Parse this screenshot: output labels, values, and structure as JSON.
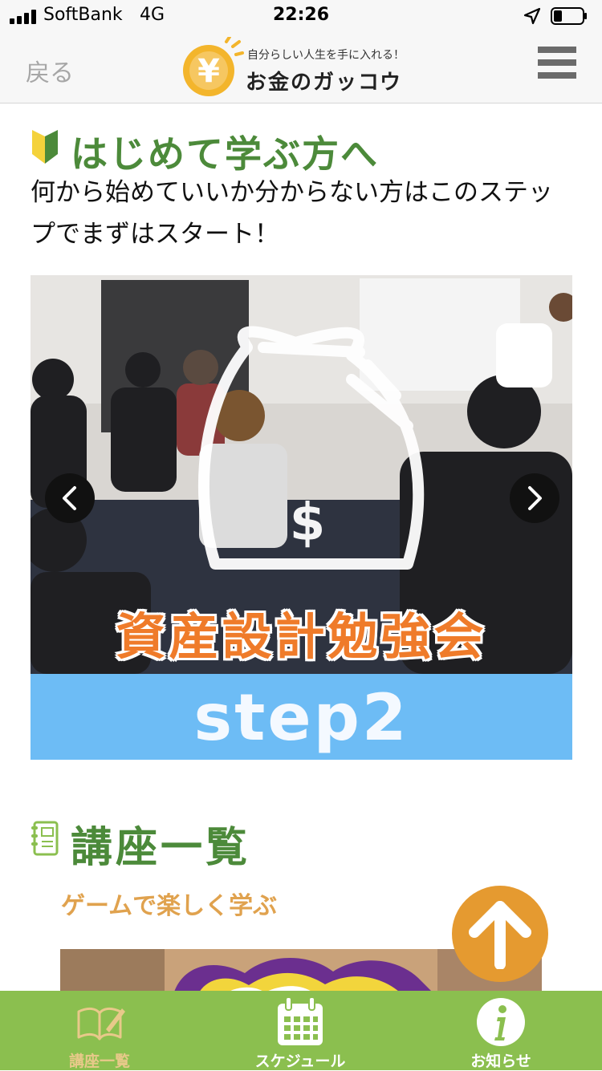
{
  "status_bar": {
    "carrier": "SoftBank",
    "network": "4G",
    "time": "22:26"
  },
  "nav": {
    "back_label": "戻る",
    "logo_tagline": "自分らしい人生を手に入れる！",
    "logo_name": "お金のガッコウ",
    "logo_mark": "¥"
  },
  "beginner_section": {
    "title": "はじめて学ぶ方へ",
    "description": "何から始めていいか分からない方はこのステップでまずはスタート！"
  },
  "slider": {
    "caption": "資産設計勉強会",
    "step_label": "step2",
    "bag_symbol": "$"
  },
  "courses_section": {
    "title": "講座一覧",
    "subtitle": "ゲームで楽しく学ぶ"
  },
  "tab_bar": {
    "items": [
      {
        "label": "講座一覧",
        "icon": "book-icon",
        "active": true
      },
      {
        "label": "スケジュール",
        "icon": "calendar-icon",
        "active": false
      },
      {
        "label": "お知らせ",
        "icon": "info-icon",
        "active": false
      }
    ]
  },
  "colors": {
    "accent_green": "#4c8a3a",
    "tab_bar_green": "#8bbf4f",
    "active_tab": "#e8c98a",
    "step_band_blue": "#6dbcf5",
    "caption_orange": "#ef7b2a",
    "back_to_top_orange": "#e59a30"
  }
}
